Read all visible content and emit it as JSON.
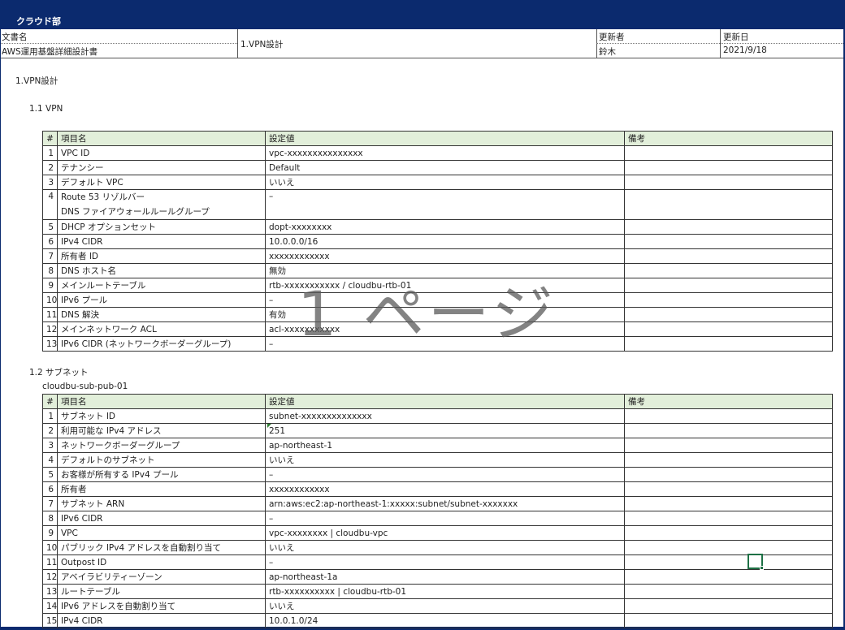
{
  "department": "クラウド部",
  "header": {
    "doc_name_label": "文書名",
    "doc_name": "AWS運用基盤詳細設計書",
    "section": "1.VPN設計",
    "updater_label": "更新者",
    "updater": "鈴木",
    "updated_label": "更新日",
    "updated": "2021/9/18"
  },
  "section_title": "1.VPN設計",
  "vpn": {
    "heading": "1.1 VPN",
    "columns": [
      "#",
      "項目名",
      "設定値",
      "備考"
    ],
    "rows": [
      {
        "no": "1",
        "name": "VPC ID",
        "value": "vpc-xxxxxxxxxxxxxxx",
        "note": ""
      },
      {
        "no": "2",
        "name": "テナンシー",
        "value": "Default",
        "note": ""
      },
      {
        "no": "3",
        "name": "デフォルト VPC",
        "value": "いいえ",
        "note": ""
      },
      {
        "no": "4",
        "name": "Route 53 リゾルバー",
        "name2": "DNS ファイアウォールルールグループ",
        "value": "–",
        "note": ""
      },
      {
        "no": "5",
        "name": "DHCP オプションセット",
        "value": "dopt-xxxxxxxx",
        "note": ""
      },
      {
        "no": "6",
        "name": "IPv4 CIDR",
        "value": "10.0.0.0/16",
        "note": ""
      },
      {
        "no": "7",
        "name": "所有者 ID",
        "value": "xxxxxxxxxxxx",
        "note": ""
      },
      {
        "no": "8",
        "name": "DNS ホスト名",
        "value": "無効",
        "note": ""
      },
      {
        "no": "9",
        "name": "メインルートテーブル",
        "value": "rtb-xxxxxxxxxxx / cloudbu-rtb-01",
        "note": ""
      },
      {
        "no": "10",
        "name": "IPv6 プール",
        "value": "–",
        "note": ""
      },
      {
        "no": "11",
        "name": "DNS 解決",
        "value": "有効",
        "note": ""
      },
      {
        "no": "12",
        "name": "メインネットワーク ACL",
        "value": "acl-xxxxxxxxxxx",
        "note": ""
      },
      {
        "no": "13",
        "name": "IPv6 CIDR (ネットワークボーダーグループ)",
        "value": "–",
        "note": ""
      }
    ]
  },
  "subnet": {
    "heading": "1.2 サブネット",
    "name": "cloudbu-sub-pub-01",
    "columns": [
      "#",
      "項目名",
      "設定値",
      "備考"
    ],
    "rows": [
      {
        "no": "1",
        "name": "サブネット ID",
        "value": "subnet-xxxxxxxxxxxxxx",
        "note": ""
      },
      {
        "no": "2",
        "name": "利用可能な IPv4 アドレス",
        "value": "251",
        "note": ""
      },
      {
        "no": "3",
        "name": "ネットワークボーダーグループ",
        "value": "ap-northeast-1",
        "note": ""
      },
      {
        "no": "4",
        "name": "デフォルトのサブネット",
        "value": "いいえ",
        "note": ""
      },
      {
        "no": "5",
        "name": "お客様が所有する IPv4 プール",
        "value": "–",
        "note": ""
      },
      {
        "no": "6",
        "name": "所有者",
        "value": "xxxxxxxxxxxx",
        "note": ""
      },
      {
        "no": "7",
        "name": "サブネット ARN",
        "value": "arn:aws:ec2:ap-northeast-1:xxxxx:subnet/subnet-xxxxxxx",
        "note": ""
      },
      {
        "no": "8",
        "name": "IPv6 CIDR",
        "value": "–",
        "note": ""
      },
      {
        "no": "9",
        "name": "VPC",
        "value": "vpc-xxxxxxxx | cloudbu-vpc",
        "note": ""
      },
      {
        "no": "10",
        "name": "パブリック IPv4 アドレスを自動割り当て",
        "value": "いいえ",
        "note": ""
      },
      {
        "no": "11",
        "name": "Outpost ID",
        "value": "–",
        "note": ""
      },
      {
        "no": "12",
        "name": "アベイラビリティーゾーン",
        "value": "ap-northeast-1a",
        "note": ""
      },
      {
        "no": "13",
        "name": "ルートテーブル",
        "value": "rtb-xxxxxxxxxx | cloudbu-rtb-01",
        "note": ""
      },
      {
        "no": "14",
        "name": "IPv6 アドレスを自動割り当て",
        "value": "いいえ",
        "note": ""
      },
      {
        "no": "15",
        "name": "IPv4 CIDR",
        "value": "10.0.1.0/24",
        "note": ""
      }
    ]
  },
  "watermark": "1 ページ",
  "colors": {
    "banner": "#0b2a6e",
    "table_header": "#e2efda",
    "selection": "#1e7145"
  }
}
